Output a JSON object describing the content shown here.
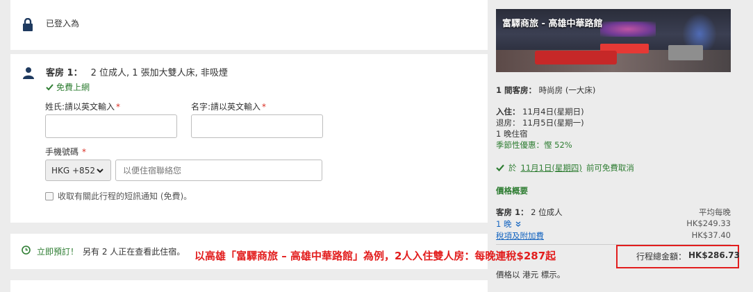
{
  "login": {
    "text": "已登入為"
  },
  "room": {
    "heading_label": "客房 1：",
    "heading_detail": "2 位成人, 1 張加大雙人床, 非吸煙",
    "wifi": "免費上網",
    "last_name_label": "姓氏:請以英文輸入",
    "first_name_label": "名字:請以英文輸入",
    "required_mark": "*",
    "phone_label": "手機號碼",
    "phone_country": "HKG +852",
    "phone_placeholder": "以便住宿聯絡您",
    "sms_optin": "收取有關此行程的短訊通知 (免費)。"
  },
  "urgency": {
    "book_now": "立即預訂！",
    "viewing": "另有 2 人正在查看此住宿。"
  },
  "annotation": "以高雄「富驛商旅 – 高雄中華路館」為例，2人入住雙人房：每晚連稅$287起",
  "hotel": {
    "name": "富驛商旅 - 高雄中華路館",
    "room_count_label": "1 間客房：",
    "room_type": "時尚房 (一大床)",
    "checkin_label": "入住：",
    "checkin_date": "11月4日(星期日)",
    "checkout_label": "退房：",
    "checkout_date": "11月5日(星期一)",
    "nights": "1 晚住宿",
    "deal": "季節性優惠：慳 52%",
    "cancel_prefix": "於",
    "cancel_date": "11月1日(星期四)",
    "cancel_suffix": "前可免費取消"
  },
  "price": {
    "title": "價格概要",
    "room_label": "客房 1：",
    "room_guests": "2 位成人",
    "avg_label": "平均每晚",
    "nights_link": "1 晚",
    "nightly_amount": "HK$249.33",
    "taxes_link": "稅項及附加費",
    "taxes_amount": "HK$37.40",
    "total_label": "行程總金額：",
    "total_amount": "HK$286.73",
    "currency_note": "價格以 港元 標示。"
  },
  "colors": {
    "accent_green": "#2e7d32",
    "link_blue": "#1565c0",
    "highlight_red": "#e21d1d",
    "icon_navy": "#1f3a5f"
  }
}
